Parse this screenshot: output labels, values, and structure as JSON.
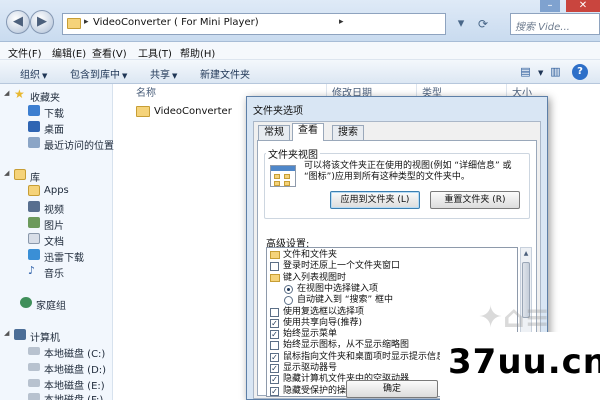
{
  "address_bar": {
    "path_root": "VideoConverter ( For Mini Player)",
    "search_placeholder": "搜索 Vide..."
  },
  "menu": [
    "文件(F)",
    "编辑(E)",
    "查看(V)",
    "工具(T)",
    "帮助(H)"
  ],
  "command_bar": {
    "organize": "组织",
    "include_library": "包含到库中",
    "share": "共享",
    "new_folder": "新建文件夹"
  },
  "sidebar": {
    "favorites": "收藏夹",
    "fav_items": [
      "下载",
      "桌面",
      "最近访问的位置"
    ],
    "libraries": "库",
    "lib_items": [
      "Apps",
      "视频",
      "图片",
      "文档",
      "迅雷下载",
      "音乐"
    ],
    "homegroup": "家庭组",
    "computer": "计算机",
    "drives": [
      "本地磁盘 (C:)",
      "本地磁盘 (D:)",
      "本地磁盘 (E:)",
      "本地磁盘 (F:)"
    ]
  },
  "columns": {
    "name": "名称",
    "modified": "修改日期",
    "type": "类型",
    "size": "大小"
  },
  "files": [
    {
      "name": "VideoConverter"
    }
  ],
  "dialog": {
    "title": "文件夹选项",
    "tabs": [
      "常规",
      "查看",
      "搜索"
    ],
    "active_tab": "查看",
    "folder_views": {
      "legend": "文件夹视图",
      "description": "可以将该文件夹正在使用的视图(例如 “详细信息” 或 “图标”)应用到所有这种类型的文件夹中。",
      "apply_button": "应用到文件夹 (L)",
      "reset_button": "重置文件夹 (R)"
    },
    "advanced_label": "高级设置:",
    "tree": [
      {
        "kind": "folder",
        "indent": 0,
        "label": "文件和文件夹"
      },
      {
        "kind": "check",
        "indent": 0,
        "checked": false,
        "label": "登录时还原上一个文件夹窗口"
      },
      {
        "kind": "folder",
        "indent": 0,
        "label": "键入列表视图时"
      },
      {
        "kind": "radio",
        "indent": 1,
        "checked": true,
        "label": "在视图中选择键入项"
      },
      {
        "kind": "radio",
        "indent": 1,
        "checked": false,
        "label": "自动键入到 “搜索” 框中"
      },
      {
        "kind": "check",
        "indent": 0,
        "checked": false,
        "label": "使用复选框以选择项"
      },
      {
        "kind": "check",
        "indent": 0,
        "checked": true,
        "label": "使用共享向导(推荐)"
      },
      {
        "kind": "check",
        "indent": 0,
        "checked": true,
        "label": "始终显示菜单"
      },
      {
        "kind": "check",
        "indent": 0,
        "checked": false,
        "label": "始终显示图标，从不显示缩略图"
      },
      {
        "kind": "check",
        "indent": 0,
        "checked": true,
        "label": "鼠标指向文件夹和桌面项时显示提示信息"
      },
      {
        "kind": "check",
        "indent": 0,
        "checked": true,
        "label": "显示驱动器号"
      },
      {
        "kind": "check",
        "indent": 0,
        "checked": true,
        "label": "隐藏计算机文件夹中的空驱动器"
      },
      {
        "kind": "check",
        "indent": 0,
        "checked": true,
        "label": "隐藏受保护的操作系统文件(推荐)"
      }
    ],
    "ok_button": "确定",
    "cancel_button": "取"
  },
  "watermark": "37uu.cn"
}
